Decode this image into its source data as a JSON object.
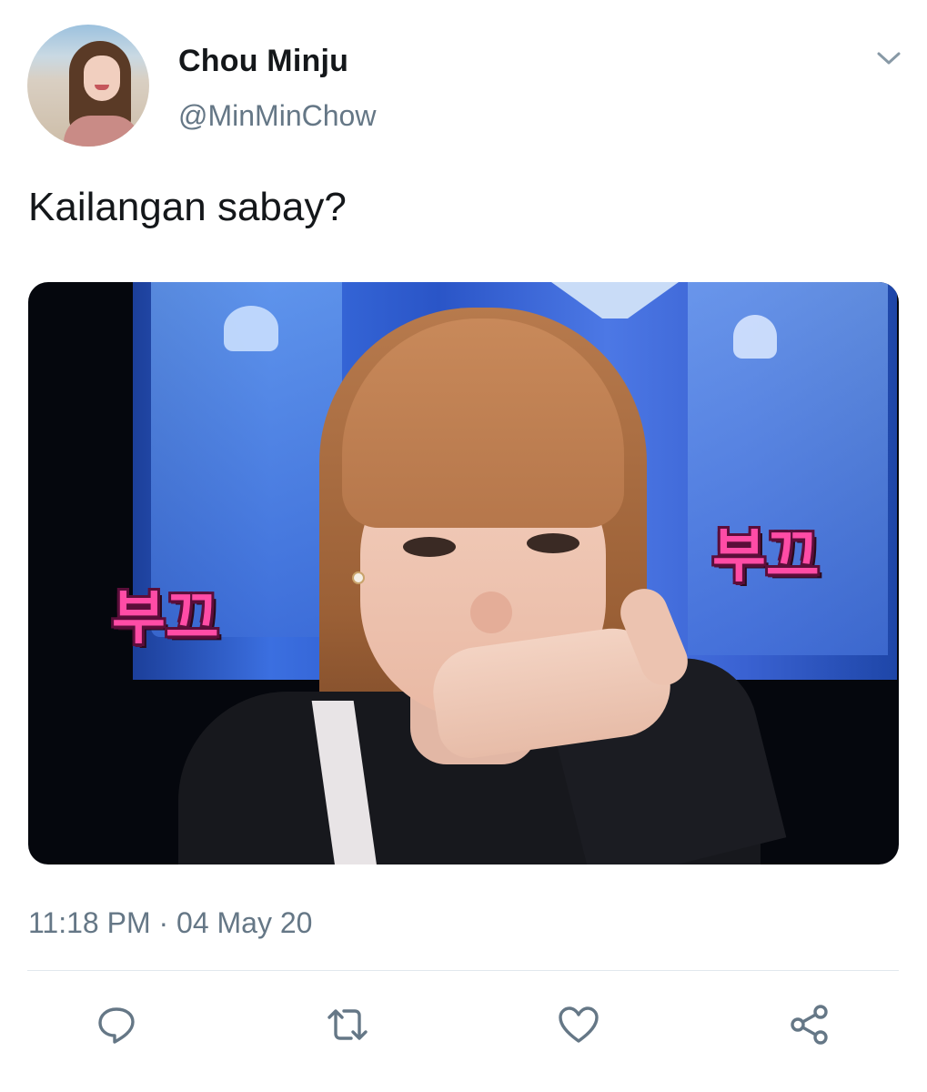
{
  "tweet": {
    "display_name": "Chou Minju",
    "handle": "@MinMinChow",
    "text": "Kailangan sabay?",
    "timestamp": "11:18 PM · 04 May 20",
    "media": {
      "overlay_left": "부끄",
      "overlay_right": "부끄"
    }
  },
  "icons": {
    "caret": "chevron-down-icon",
    "reply": "reply-icon",
    "retweet": "retweet-icon",
    "like": "heart-icon",
    "share": "share-icon"
  },
  "colors": {
    "text_primary": "#14171a",
    "text_secondary": "#657786",
    "icon": "#657786",
    "divider": "#e1e8ed",
    "sticker_pink": "#ff4ca6"
  }
}
